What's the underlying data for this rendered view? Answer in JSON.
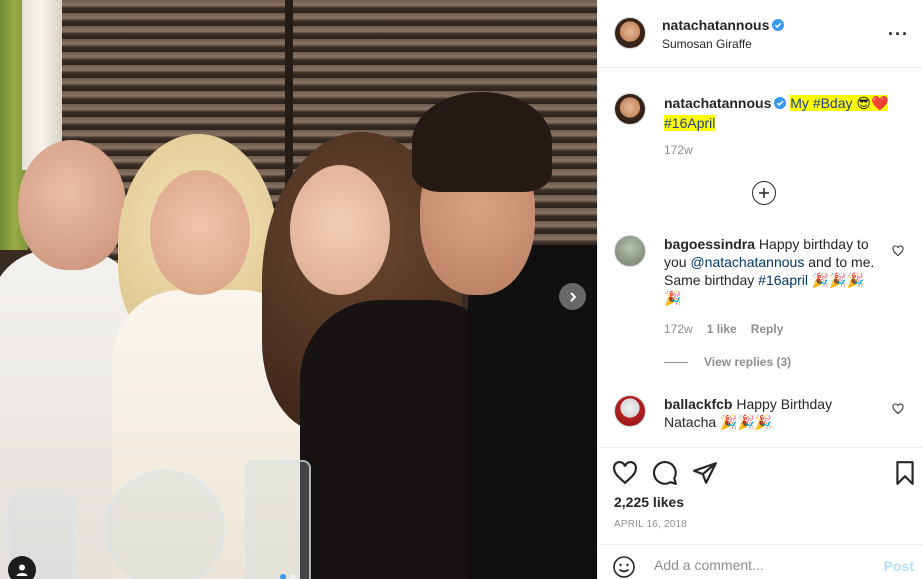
{
  "header": {
    "username": "natachatannous",
    "location": "Sumosan Giraffe",
    "more_label": "···"
  },
  "caption": {
    "username": "natachatannous",
    "text_plain": "My",
    "hashtag1": "#Bday",
    "emojis": "😎❤️",
    "hashtag2": "#16April",
    "time": "172w"
  },
  "load_more_label": "+",
  "comments": [
    {
      "username": "bagoessindra",
      "text_before": "Happy birthday to you",
      "mention": "@natachatannous",
      "text_after": "and to me. Same birthday",
      "hashtag": "#16april",
      "emojis": "🎉🎉🎉 🎉",
      "time": "172w",
      "likes": "1 like",
      "reply_label": "Reply",
      "view_replies": "View replies (3)"
    },
    {
      "username": "ballackfcb",
      "text": "Happy Birthday Natacha",
      "emojis": "🎉🎉🎉"
    }
  ],
  "actions": {
    "likes": "2,225 likes",
    "date": "APRIL 16, 2018"
  },
  "add_comment": {
    "placeholder": "Add a comment...",
    "post_label": "Post"
  },
  "colors": {
    "verified": "#3897f0",
    "highlight": "#ffff00",
    "link": "#00376b",
    "muted": "#8e8e8e"
  },
  "icons": [
    "verified-icon",
    "more-icon",
    "plus-circle-icon",
    "heart-icon",
    "comment-icon",
    "share-icon",
    "bookmark-icon",
    "emoji-icon",
    "chevron-right-icon",
    "user-tag-icon"
  ]
}
